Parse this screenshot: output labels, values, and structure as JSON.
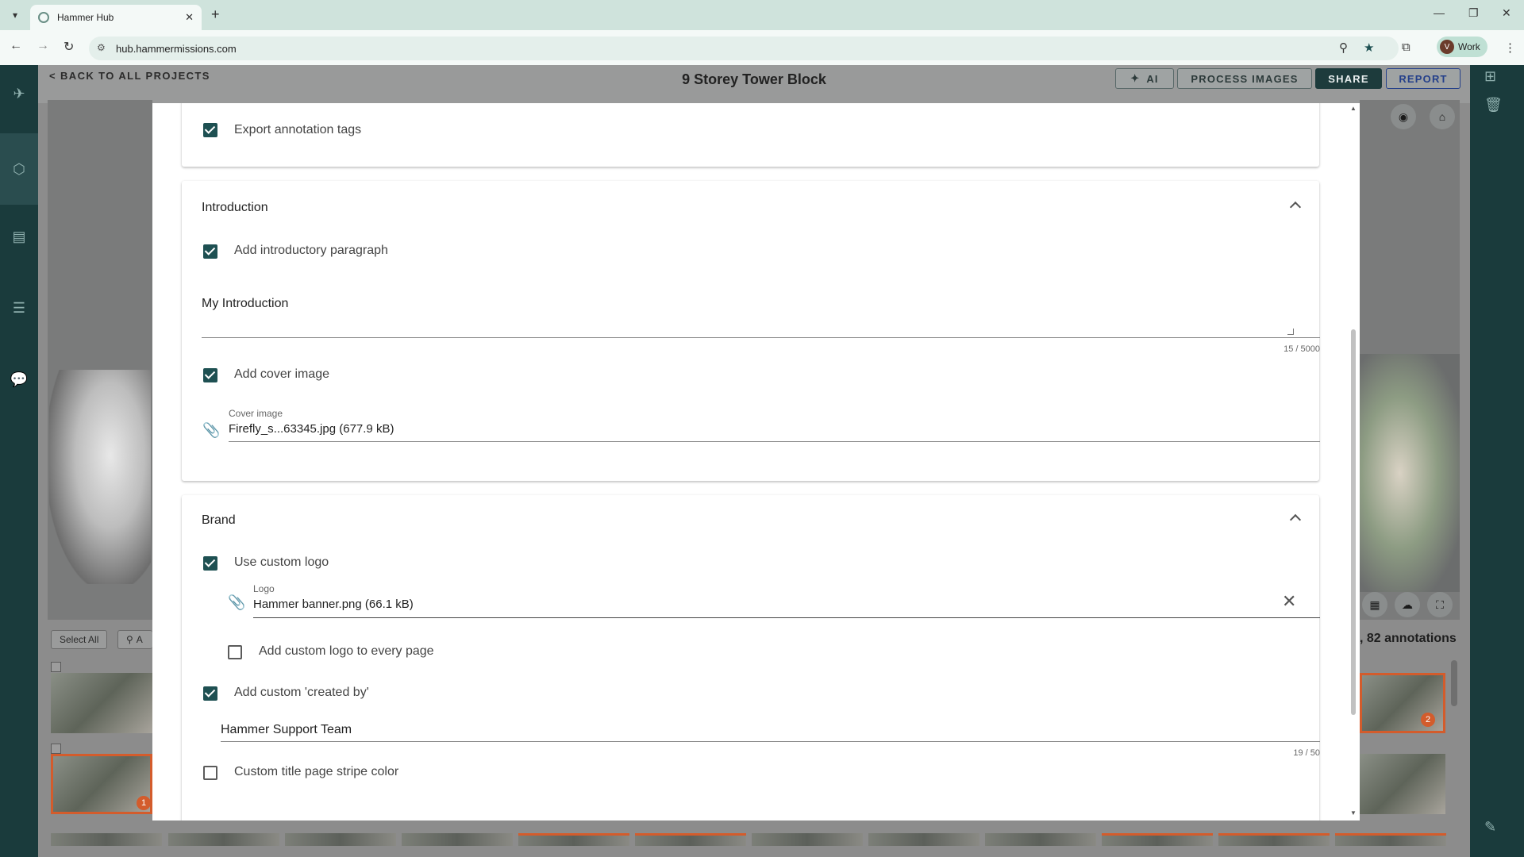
{
  "browser": {
    "tab_title": "Hammer Hub",
    "url": "hub.hammermissions.com",
    "profile_initial": "V",
    "profile_label": "Work"
  },
  "header": {
    "back_link": "< BACK TO ALL PROJECTS",
    "project_title": "9 Storey Tower Block",
    "ai_button": "AI",
    "process_images_button": "PROCESS IMAGES",
    "share_button": "SHARE",
    "report_button": "REPORT"
  },
  "gallery": {
    "select_all": "Select All",
    "ai_filter": "A",
    "annotations_text": ", 82 annotations",
    "badges": [
      "1",
      "2"
    ]
  },
  "report": {
    "export_annotation_tags": "Export annotation tags",
    "introduction": {
      "title": "Introduction",
      "add_intro_label": "Add introductory paragraph",
      "intro_text": "My Introduction",
      "intro_counter": "15 / 5000",
      "add_cover_label": "Add cover image",
      "cover_field_label": "Cover image",
      "cover_file": "Firefly_s...63345.jpg (677.9 kB)"
    },
    "brand": {
      "title": "Brand",
      "use_custom_logo_label": "Use custom logo",
      "logo_field_label": "Logo",
      "logo_file": "Hammer banner.png (66.1 kB)",
      "logo_every_page_label": "Add custom logo to every page",
      "created_by_label": "Add custom 'created by'",
      "created_by_value": "Hammer Support Team",
      "created_by_counter": "19 / 50",
      "stripe_color_label": "Custom title page stripe color"
    }
  },
  "checkbox_states": {
    "export_annotation_tags": true,
    "add_intro": true,
    "add_cover": true,
    "use_custom_logo": true,
    "logo_every_page": false,
    "created_by": true,
    "stripe_color": false
  },
  "colors": {
    "accent": "#1e5052",
    "sidebar": "#1a3b3c",
    "selection": "#d35c2c",
    "report_button": "#24408a"
  }
}
